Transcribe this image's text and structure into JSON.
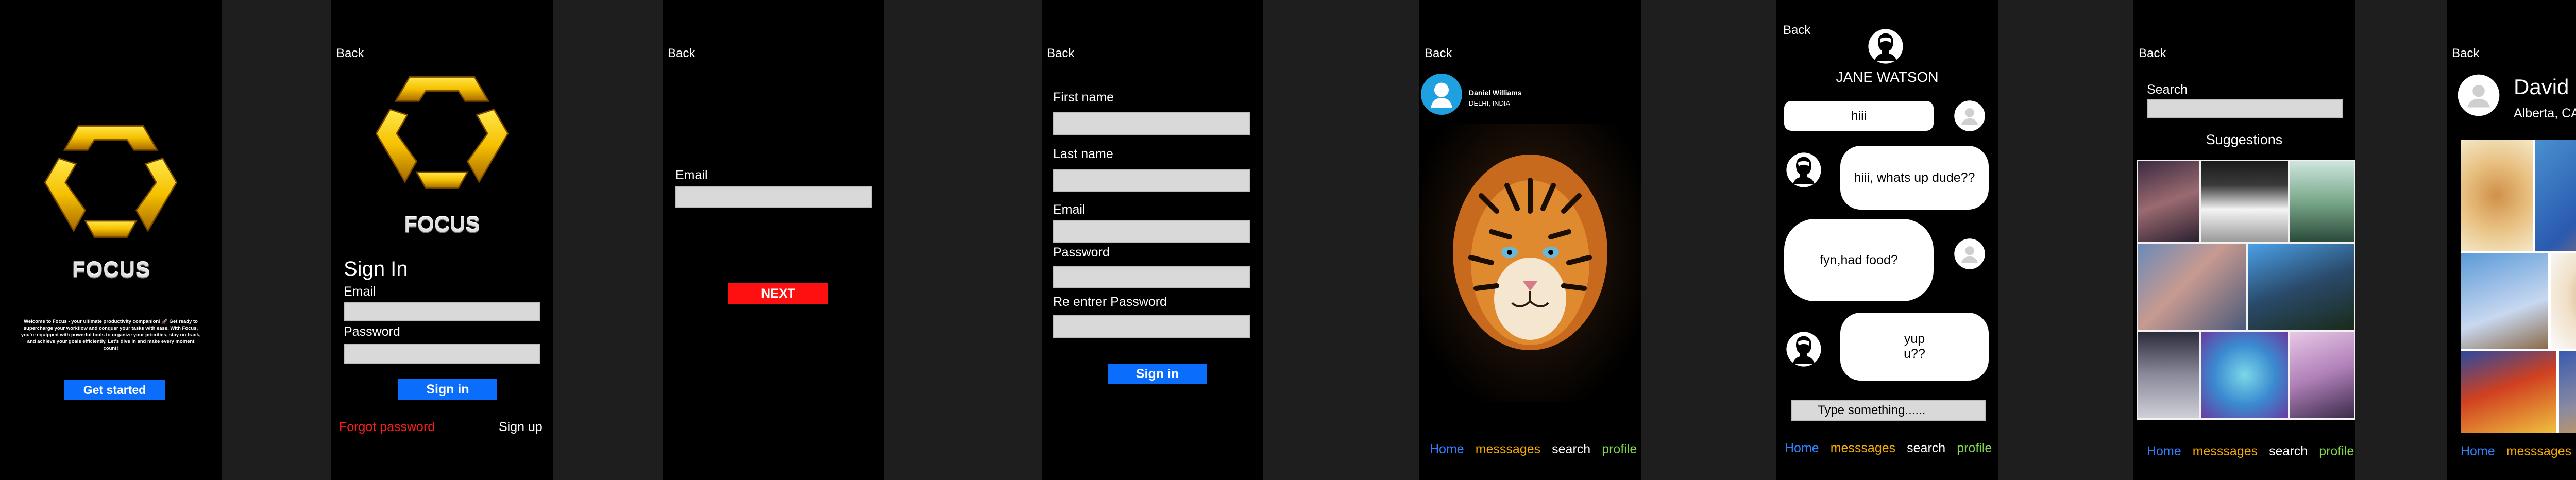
{
  "brand": {
    "name": "FOCUS",
    "welcome": "Welcome to Focus - your ultimate productivity companion! 🚀 Get ready to supercharge your workflow and conquer your tasks with ease. With Focus, you're equipped with powerful tools to organize your priorities, stay on track, and achieve your goals efficiently. Let's dive in and make every moment count!"
  },
  "common": {
    "back": "Back"
  },
  "splash": {
    "get_started": "Get started"
  },
  "signin": {
    "title": "Sign In",
    "email_label": "Email",
    "password_label": "Password",
    "submit": "Sign in",
    "forgot": "Forgot password",
    "signup": "Sign up"
  },
  "email_step": {
    "email_label": "Email",
    "next": "NEXT"
  },
  "register": {
    "first_name": "First name",
    "last_name": "Last name",
    "email": "Email",
    "password": "Password",
    "reenter": "Re entrer Password",
    "submit": "Sign in"
  },
  "feed": {
    "user_name": "Daniel Williams",
    "user_location": "DELHI, INDIA"
  },
  "chat": {
    "contact": "JANE WATSON",
    "messages": [
      "hiii",
      "hiii, whats up dude??",
      "fyn,had food?",
      "yup\nu??"
    ],
    "input_placeholder": "Type something......"
  },
  "search_page": {
    "label": "Search",
    "suggestions": "Suggestions"
  },
  "profile": {
    "name": "David",
    "location": "Alberta, CA"
  },
  "nav": {
    "home": "Home",
    "messages": "messsages",
    "search": "search",
    "profile": "profile"
  },
  "colors": {
    "accent_blue": "#0b6dfc",
    "next_red": "#ff1010",
    "forgot_red": "#ff1a1a",
    "nav_home": "#2f80ff",
    "nav_messages": "#f2a900",
    "nav_profile": "#7fd64a",
    "logo_gold": "#f5c000"
  },
  "icons": [
    "logo-hexagon-icon",
    "avatar-icon",
    "user-silhouette-icon"
  ]
}
